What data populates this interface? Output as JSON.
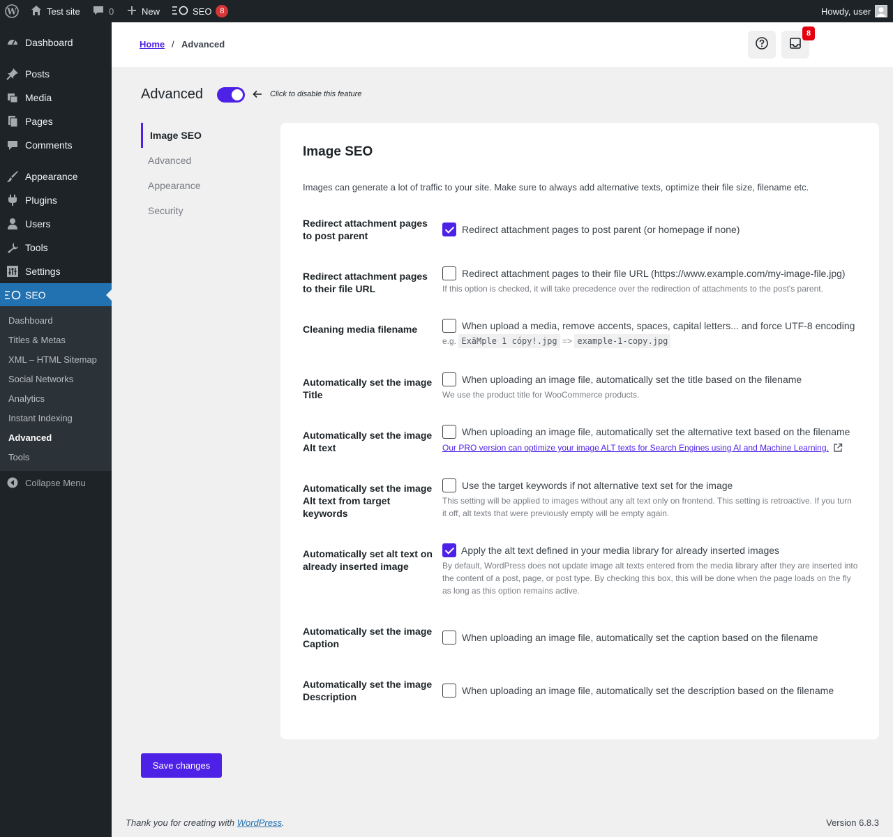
{
  "adminbar": {
    "site_name": "Test site",
    "comments_count": "0",
    "new_label": "New",
    "seo_label": "SEO",
    "seo_badge": "8",
    "howdy": "Howdy, user"
  },
  "sidebar": {
    "items": [
      {
        "label": "Dashboard",
        "icon": "dashboard-icon"
      },
      {
        "label": "Posts",
        "icon": "pin-icon"
      },
      {
        "label": "Media",
        "icon": "media-icon"
      },
      {
        "label": "Pages",
        "icon": "pages-icon"
      },
      {
        "label": "Comments",
        "icon": "comment-icon"
      },
      {
        "label": "Appearance",
        "icon": "brush-icon"
      },
      {
        "label": "Plugins",
        "icon": "plugin-icon"
      },
      {
        "label": "Users",
        "icon": "user-icon"
      },
      {
        "label": "Tools",
        "icon": "wrench-icon"
      },
      {
        "label": "Settings",
        "icon": "settings-icon"
      },
      {
        "label": "SEO",
        "icon": "seo-icon"
      }
    ],
    "submenu": [
      "Dashboard",
      "Titles & Metas",
      "XML – HTML Sitemap",
      "Social Networks",
      "Analytics",
      "Instant Indexing",
      "Advanced",
      "Tools"
    ],
    "collapse_label": "Collapse Menu"
  },
  "topbar": {
    "home": "Home",
    "separator": "/",
    "current": "Advanced",
    "notifications_badge": "8"
  },
  "page": {
    "title": "Advanced",
    "toggle_hint": "Click to disable this feature",
    "toggle_on": true
  },
  "subnav": [
    "Image SEO",
    "Advanced",
    "Appearance",
    "Security"
  ],
  "card": {
    "title": "Image SEO",
    "description": "Images can generate a lot of traffic to your site. Make sure to always add alternative texts, optimize their file size, filename etc.",
    "rows": [
      {
        "label": "Redirect attachment pages to post parent",
        "option": "Redirect attachment pages to post parent (or homepage if none)",
        "checked": true
      },
      {
        "label": "Redirect attachment pages to their file URL",
        "option": "Redirect attachment pages to their file URL (https://www.example.com/my-image-file.jpg)",
        "checked": false,
        "help": "If this option is checked, it will take precedence over the redirection of attachments to the post's parent."
      },
      {
        "label": "Cleaning media filename",
        "option": "When upload a media, remove accents, spaces, capital letters... and force UTF-8 encoding",
        "checked": false,
        "help_prefix": "e.g.",
        "example_before": "ExãMple 1 cópy!.jpg",
        "example_arrow": "=>",
        "example_after": "example-1-copy.jpg"
      },
      {
        "label": "Automatically set the image Title",
        "option": "When uploading an image file, automatically set the title based on the filename",
        "checked": false,
        "help": "We use the product title for WooCommerce products."
      },
      {
        "label": "Automatically set the image Alt text",
        "option": "When uploading an image file, automatically set the alternative text based on the filename",
        "checked": false,
        "link": "Our PRO version can optimize your image ALT texts for Search Engines using AI and Machine Learning."
      },
      {
        "label": "Automatically set the image Alt text from target keywords",
        "option": "Use the target keywords if not alternative text set for the image",
        "checked": false,
        "help": "This setting will be applied to images without any alt text only on frontend. This setting is retroactive. If you turn it off, alt texts that were previously empty will be empty again."
      },
      {
        "label": "Automatically set alt text on already inserted image",
        "option": "Apply the alt text defined in your media library for already inserted images",
        "checked": true,
        "help": "By default, WordPress does not update image alt texts entered from the media library after they are inserted into the content of a post, page, or post type. By checking this box, this will be done when the page loads on the fly as long as this option remains active."
      },
      {
        "label": "Automatically set the image Caption",
        "option": "When uploading an image file, automatically set the caption based on the filename",
        "checked": false
      },
      {
        "label": "Automatically set the image Description",
        "option": "When uploading an image file, automatically set the description based on the filename",
        "checked": false
      }
    ]
  },
  "save_label": "Save changes",
  "footer": {
    "thanks_prefix": "Thank you for creating with",
    "wp_link": "WordPress",
    "thanks_suffix": ".",
    "version": "Version 6.8.3"
  },
  "colors": {
    "accent": "#4e21e7",
    "admin_dark": "#1d2327",
    "wp_blue": "#2271b1",
    "badge_red": "#d63638"
  }
}
